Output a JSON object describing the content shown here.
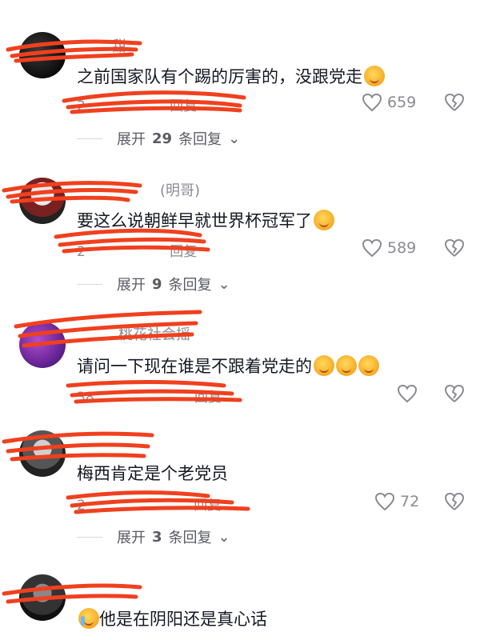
{
  "comments": [
    {
      "nick": "甜",
      "text": "之前国家队有个踢的厉害的，没跟党走",
      "emojis": [
        "grin-emoji"
      ],
      "meta_time": "2",
      "meta_reply": "回复",
      "likes": "659",
      "expand": {
        "prefix": "展开",
        "count": "29",
        "suffix": "条回复"
      }
    },
    {
      "nick": "(明哥)",
      "text": "要这么说朝鲜早就世界杯冠军了",
      "emojis": [
        "smile-emoji"
      ],
      "meta_time": "2",
      "meta_reply": "回复",
      "likes": "589",
      "expand": {
        "prefix": "展开",
        "count": "9",
        "suffix": "条回复"
      }
    },
    {
      "nick": "桃花社会摇",
      "text": "请问一下现在谁是不跟着党走的",
      "emojis": [
        "grin-emoji",
        "grin-emoji",
        "grin-emoji"
      ],
      "meta_time": "38",
      "meta_reply": "回复",
      "likes": ""
    },
    {
      "nick": "",
      "text": "梅西肯定是个老党员",
      "emojis": [],
      "meta_time": "2",
      "meta_reply": "回复",
      "likes": "72",
      "expand": {
        "prefix": "展开",
        "count": "3",
        "suffix": "条回复"
      }
    },
    {
      "nick": "",
      "text": "他是在阴阳还是真心话",
      "emojis": [
        "cry-emoji"
      ],
      "meta_time": "",
      "meta_reply": "",
      "likes": ""
    }
  ],
  "colors": {
    "text": "#161823",
    "muted": "#8a8b91",
    "scribble": "#f0401e"
  }
}
